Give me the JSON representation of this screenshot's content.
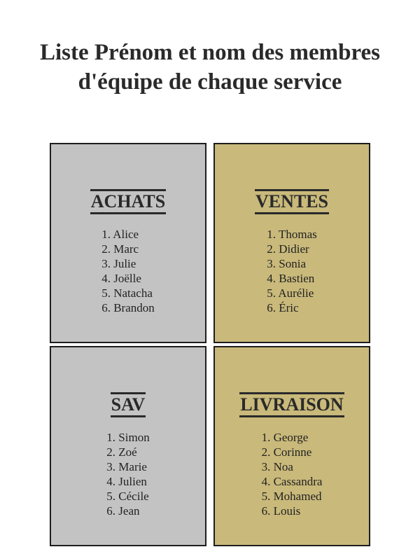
{
  "title": "Liste Prénom et nom des membres d'équipe de chaque service",
  "colors": {
    "gray_card": "#c3c3c3",
    "gold_card": "#c9b97a",
    "border": "#1e1e1e",
    "text": "#222222"
  },
  "services": [
    {
      "name": "ACHATS",
      "color": "#c3c3c3",
      "members": [
        "1. Alice",
        "2. Marc",
        "3. Julie",
        "4. Joëlle",
        "5. Natacha",
        "6. Brandon"
      ]
    },
    {
      "name": "VENTES",
      "color": "#c9b97a",
      "members": [
        "1. Thomas",
        "2. Didier",
        "3. Sonia",
        "4. Bastien",
        "5. Aurélie",
        "6. Éric"
      ]
    },
    {
      "name": "SAV",
      "color": "#c3c3c3",
      "members": [
        "1. Simon",
        "2. Zoé",
        "3. Marie",
        "4. Julien",
        "5. Cécile",
        "6. Jean"
      ]
    },
    {
      "name": "LIVRAISON",
      "color": "#c9b97a",
      "members": [
        "1. George",
        "2. Corinne",
        "3. Noa",
        "4. Cassandra",
        "5. Mohamed",
        "6. Louis"
      ]
    }
  ]
}
